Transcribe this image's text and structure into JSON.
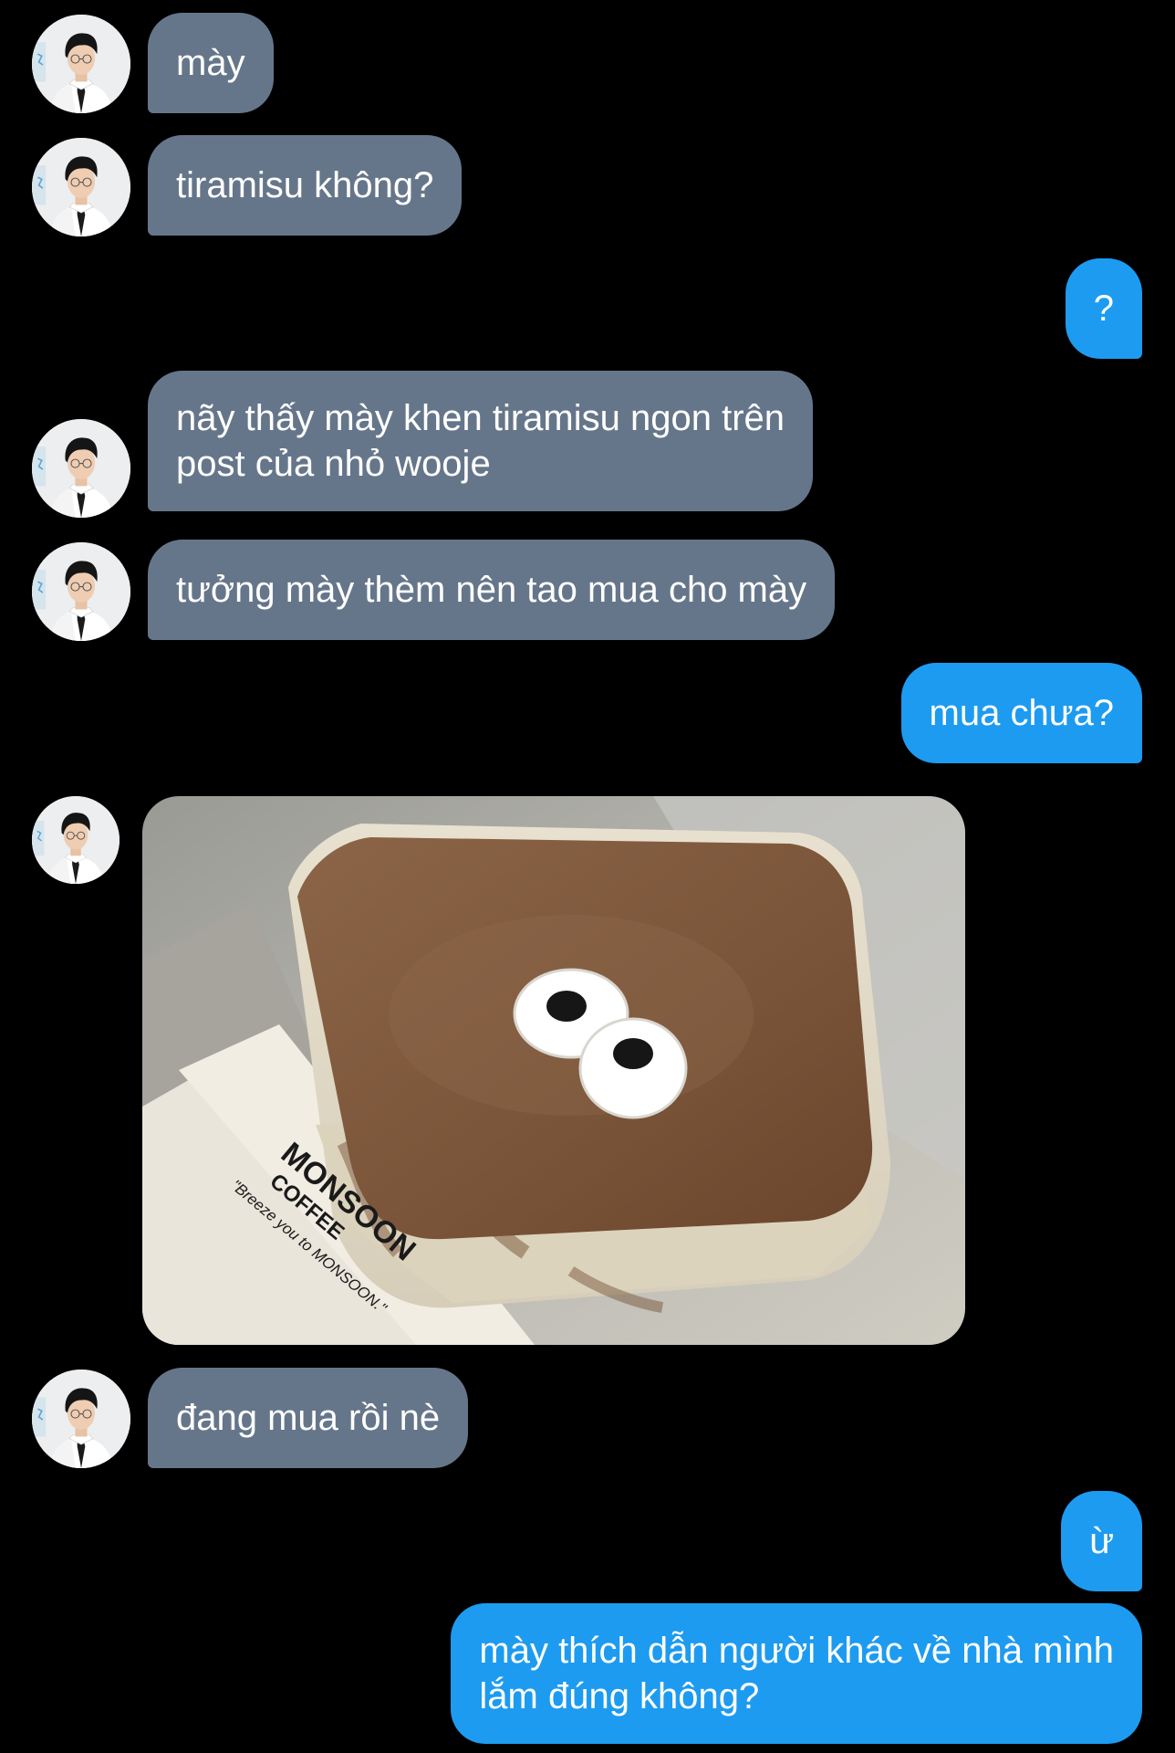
{
  "messages": [
    {
      "sender": "them",
      "text": "mày"
    },
    {
      "sender": "them",
      "text": "tiramisu không?"
    },
    {
      "sender": "me",
      "text": "?"
    },
    {
      "sender": "them",
      "line1": "nãy thấy mày khen tiramisu ngon trên",
      "line2": "post của nhỏ wooje"
    },
    {
      "sender": "them",
      "text": "tưởng mày thèm nên tao mua cho mày"
    },
    {
      "sender": "me",
      "text": "mua chưa?"
    },
    {
      "sender": "them",
      "type": "image",
      "napkin": {
        "brand": "MONSOON",
        "sub": "COFFEE",
        "tagline": "\"Breeze you to MONSOON.\""
      }
    },
    {
      "sender": "them",
      "text": "đang mua rồi nè"
    },
    {
      "sender": "me",
      "text": "ừ"
    },
    {
      "sender": "me",
      "line1": "mày thích dẫn người khác về nhà mình",
      "line2": "lắm đúng không?"
    }
  ],
  "colors": {
    "background": "#000000",
    "incoming_bubble": "#66768a",
    "outgoing_bubble": "#1d9bf0",
    "text": "#ffffff"
  },
  "icons": {
    "avatar": "user-avatar-photo"
  }
}
